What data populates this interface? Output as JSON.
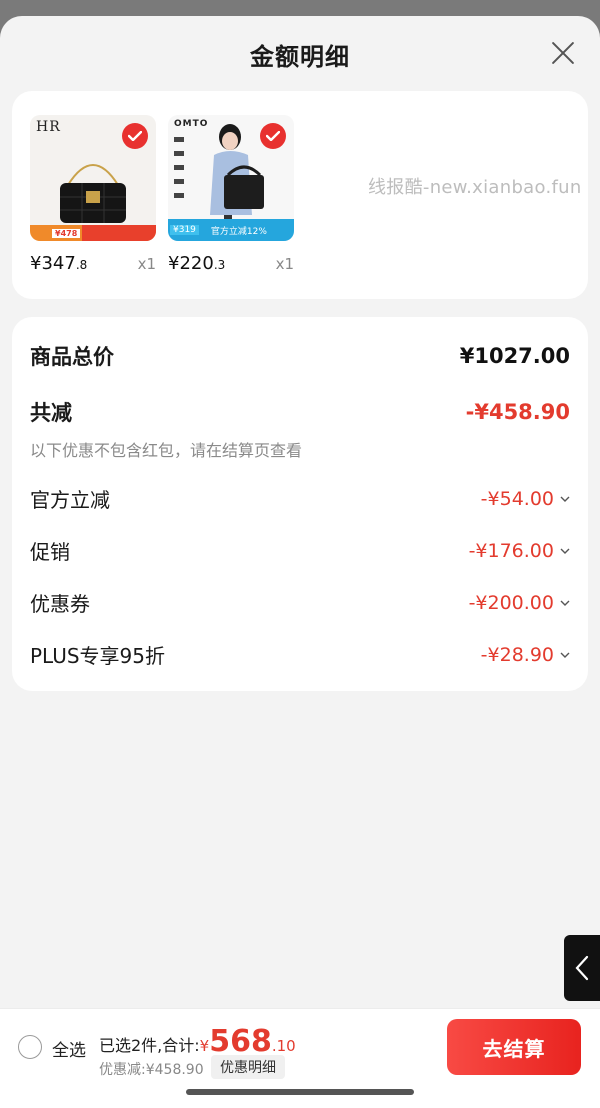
{
  "header": {
    "title": "金额明细"
  },
  "goods": [
    {
      "brand": "HR",
      "promo": "¥478",
      "price_int": "¥347",
      "price_dec": ".8",
      "qty": "x1"
    },
    {
      "brand": "OMTO",
      "promo": "¥319",
      "promo_label": "官方立减12%",
      "price_int": "¥220",
      "price_dec": ".3",
      "qty": "x1"
    }
  ],
  "watermark": "线报酷-new.xianbao.fun",
  "summary": {
    "total_label": "商品总价",
    "total_value": "¥1027.00",
    "reduce_label": "共减",
    "reduce_value": "-¥458.90",
    "note": "以下优惠不包含红包，请在结算页查看",
    "discounts": [
      {
        "label": "官方立减",
        "value": "-¥54.00"
      },
      {
        "label": "促销",
        "value": "-¥176.00"
      },
      {
        "label": "优惠券",
        "value": "-¥200.00"
      },
      {
        "label": "PLUS专享95折",
        "value": "-¥28.90"
      }
    ]
  },
  "bottom": {
    "select_all": "全选",
    "chosen_text": "已选2件,合计:",
    "currency": "¥",
    "total_int": "568",
    "total_dec": ".10",
    "saved": "优惠减:¥458.90",
    "detail_btn": "优惠明细",
    "checkout": "去结算"
  },
  "colors": {
    "accent": "#e33b2e",
    "button": "#f03a33"
  },
  "icons": [
    "close-icon",
    "check-icon",
    "chevron-down-icon",
    "chevron-left-icon"
  ]
}
